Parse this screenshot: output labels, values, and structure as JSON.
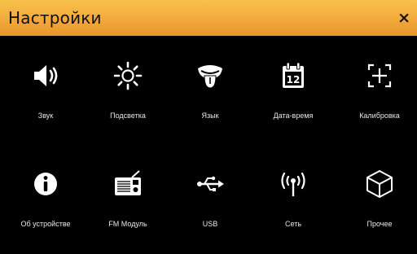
{
  "window": {
    "title": "Настройки",
    "close_glyph": "×"
  },
  "colors": {
    "titlebar": "#f2a93b",
    "background": "#000000",
    "icon": "#ffffff",
    "label": "#e8e8e8"
  },
  "tiles": [
    {
      "label": "Звук",
      "icon": "speaker-icon"
    },
    {
      "label": "Подсветка",
      "icon": "brightness-icon"
    },
    {
      "label": "Язык",
      "icon": "tongue-icon"
    },
    {
      "label": "Дата-время",
      "icon": "calendar-icon"
    },
    {
      "label": "Калибровка",
      "icon": "crosshair-icon"
    },
    {
      "label": "Об устройстве",
      "icon": "info-icon"
    },
    {
      "label": "FM Модуль",
      "icon": "radio-icon"
    },
    {
      "label": "USB",
      "icon": "usb-icon"
    },
    {
      "label": "Сеть",
      "icon": "antenna-icon"
    },
    {
      "label": "Прочее",
      "icon": "cube-icon"
    }
  ],
  "calendar_day": "12"
}
